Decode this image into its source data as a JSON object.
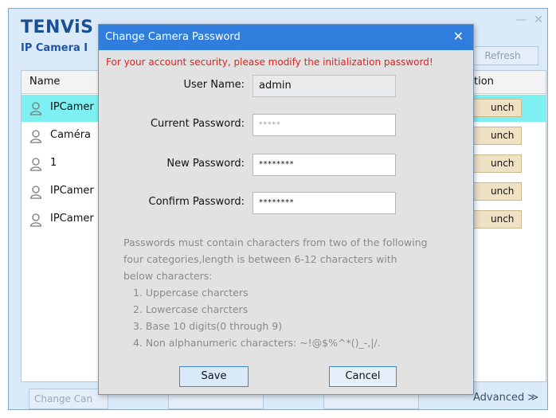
{
  "app": {
    "logo": "TENViS",
    "subtitle": "IP Camera I",
    "refresh_label": "Refresh",
    "minimize": "—",
    "close": "✕"
  },
  "list": {
    "columns": {
      "name": "Name",
      "action": "tion"
    },
    "rows": [
      {
        "name": "IPCamer",
        "action": "unch"
      },
      {
        "name": "Caméra",
        "action": "unch"
      },
      {
        "name": "1",
        "action": "unch"
      },
      {
        "name": "IPCamer",
        "action": "unch"
      },
      {
        "name": "IPCamer",
        "action": "unch"
      }
    ],
    "selected_row_color": "#7ef0f2"
  },
  "bottom": {
    "change_camera_label": "Change Can",
    "advanced_label": "Advanced ≫"
  },
  "dialog": {
    "title": "Change Camera Password",
    "close": "✕",
    "warning": "For your account security, please modify the initialization password!",
    "user_name_label": "User Name:",
    "user_name_value": "admin",
    "current_password_label": "Current Password:",
    "current_password_value": "*****",
    "new_password_label": "New Password:",
    "new_password_value": "********",
    "confirm_password_label": "Confirm Password:",
    "confirm_password_value": "********",
    "rules_intro_1": "Passwords must contain characters from two of the following",
    "rules_intro_2": "four categories,length is between 6-12 characters with",
    "rules_intro_3": "below characters:",
    "rules": [
      "1. Uppercase charcters",
      "2. Lowercase charcters",
      "3. Base 10 digits(0 through 9)",
      "4. Non alphanumeric characters: ~!@$%^*()_-,|/."
    ],
    "save_label": "Save",
    "cancel_label": "Cancel",
    "titlebar_color": "#2f7ede",
    "warning_color": "#e41e1e"
  }
}
